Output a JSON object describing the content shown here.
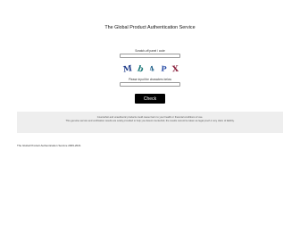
{
  "header": {
    "title": "The Global Product Authentication Service"
  },
  "form": {
    "code_label": "Scratch-off panel / code",
    "code_value": "",
    "captcha_label": "Please input the characters below",
    "captcha_value": "",
    "captcha_chars": [
      "M",
      "b",
      "4",
      "P",
      "X"
    ],
    "check_label": "Check"
  },
  "info": {
    "line1": "Counterfeit and unauthentic products could cause harm to your health or financial conditions of use.",
    "line2": "This genuine service and verification results are solely provided to help you detect counterfeit; the results cannot be taken as legal proof or any claim of liability."
  },
  "footer": {
    "copyright": "The Global Product Authentication Service 2009-2021"
  },
  "colors": {
    "button_bg": "#000000",
    "button_text": "#ffffff",
    "info_bg": "#eeeeee"
  }
}
